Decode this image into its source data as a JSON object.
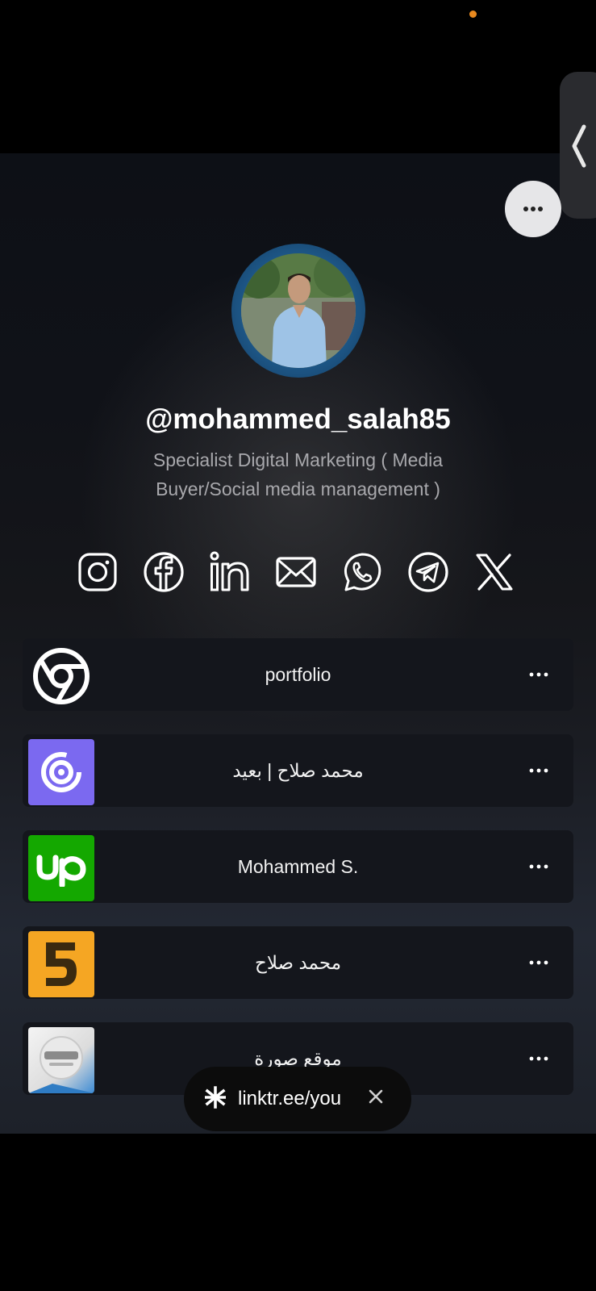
{
  "profile": {
    "username": "@mohammed_salah85",
    "bio": "Specialist Digital Marketing ( Media Buyer/Social media management )"
  },
  "socials": [
    {
      "icon": "instagram-icon"
    },
    {
      "icon": "facebook-icon"
    },
    {
      "icon": "linkedin-icon"
    },
    {
      "icon": "email-icon"
    },
    {
      "icon": "whatsapp-icon"
    },
    {
      "icon": "telegram-icon"
    },
    {
      "icon": "x-icon"
    }
  ],
  "links": [
    {
      "label": "portfolio",
      "icon": "chrome-icon"
    },
    {
      "label": "محمد صلاح | بعيد",
      "icon": "baeed-icon"
    },
    {
      "label": "Mohammed S.",
      "icon": "upwork-icon"
    },
    {
      "label": "محمد صلاح",
      "icon": "khamsat-icon"
    },
    {
      "label": "موقع صورة",
      "icon": "sora-icon"
    }
  ],
  "toast": {
    "text": "linktr.ee/you"
  },
  "colors": {
    "background": "#000000",
    "card": "#14161c",
    "status_dot": "#e8891f",
    "upwork": "#14a800",
    "baeed": "#7b69f0",
    "khamsat": "#f5a623"
  }
}
